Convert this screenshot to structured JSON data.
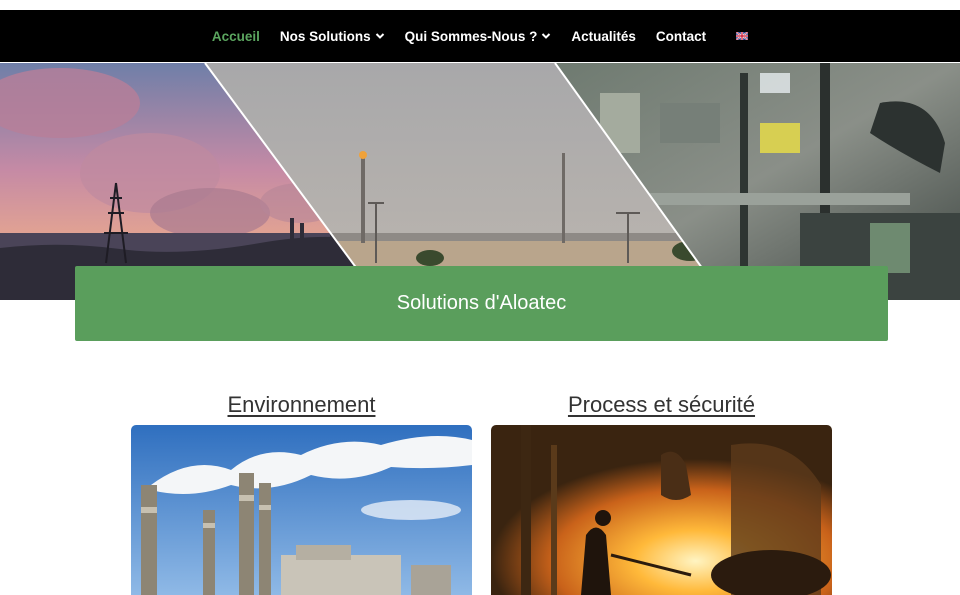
{
  "nav": {
    "items": [
      {
        "label": "Accueil",
        "active": true,
        "dropdown": false
      },
      {
        "label": "Nos Solutions",
        "active": false,
        "dropdown": true
      },
      {
        "label": "Qui Sommes-Nous ?",
        "active": false,
        "dropdown": true
      },
      {
        "label": "Actualités",
        "active": false,
        "dropdown": false
      },
      {
        "label": "Contact",
        "active": false,
        "dropdown": false
      }
    ],
    "language_icon": "uk-flag-icon",
    "active_color": "#5ba55f",
    "background_color": "#000000"
  },
  "hero": {
    "banner_title": "Solutions d'Aloatec",
    "banner_color": "#5a9e5c"
  },
  "cards": [
    {
      "title": "Environnement",
      "image": "factory-chimneys-image"
    },
    {
      "title": "Process et sécurité",
      "image": "molten-metal-foundry-image"
    }
  ]
}
